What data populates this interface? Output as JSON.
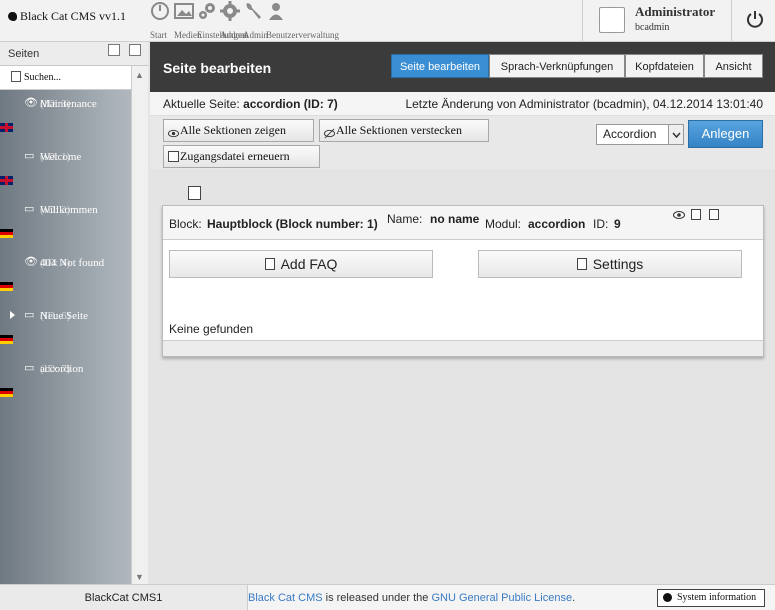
{
  "app": {
    "title": "Black Cat CMS vv1.1"
  },
  "topnav": {
    "items": [
      {
        "label": "Start",
        "icon": "dashboard-icon"
      },
      {
        "label": "Medien",
        "icon": "image-icon"
      },
      {
        "label": "Einstellungen",
        "icon": "gears-icon"
      },
      {
        "label": "Addons",
        "icon": "puzzle-gear-icon"
      },
      {
        "label": "Admin",
        "icon": "wrench-icon"
      },
      {
        "label": "Benutzerverwaltung",
        "icon": "users-icon"
      }
    ]
  },
  "user": {
    "display_name": "Administrator",
    "login": "bcadmin"
  },
  "sidebar": {
    "title": "Seiten",
    "search_label": "Suchen...",
    "pages": [
      {
        "name": "Maintenance",
        "id": "(ID: 3)",
        "icon": "eye-icon",
        "flag": "uk",
        "expandable": false
      },
      {
        "name": "Welcome",
        "id": "(ID: 1)",
        "icon": "monitor-icon",
        "flag": "uk",
        "expandable": false
      },
      {
        "name": "Willkommen",
        "id": "(ID: 2)",
        "icon": "monitor-icon",
        "flag": "de",
        "expandable": false
      },
      {
        "name": "404 Not found",
        "id": "(ID: 4)",
        "icon": "eye-icon",
        "flag": "de",
        "expandable": false
      },
      {
        "name": "Neue Seite",
        "id": "(ID: 6)",
        "icon": "monitor-icon",
        "flag": "de",
        "expandable": true
      },
      {
        "name": "accordion",
        "id": "(ID: 7)",
        "icon": "monitor-icon",
        "flag": "de",
        "expandable": false
      }
    ]
  },
  "panel": {
    "title": "Seite bearbeiten",
    "tabs": [
      {
        "label": "Seite bearbeiten",
        "active": true
      },
      {
        "label": "Sprach-Verknüpfungen",
        "active": false
      },
      {
        "label": "Kopfdateien",
        "active": false
      },
      {
        "label": "Ansicht",
        "active": false
      }
    ]
  },
  "info": {
    "current_page_label": "Aktuelle Seite:",
    "current_page_value": "accordion (ID: 7)",
    "last_change": "Letzte Änderung von Administrator (bcadmin), 04.12.2014 13:01:40"
  },
  "toolbar": {
    "show_all": "Alle Sektionen zeigen",
    "hide_all": "Alle Sektionen verstecken",
    "renew_access": "Zugangsdatei erneuern",
    "section_type_selected": "Accordion",
    "add_button": "Anlegen"
  },
  "block": {
    "block_label": "Block:",
    "block_value": "Hauptblock (Block number: 1)",
    "name_label": "Name:",
    "name_value": "no name",
    "module_label": "Modul:",
    "module_value": "accordion",
    "id_label": "ID:",
    "id_value": "9",
    "add_faq": "Add FAQ",
    "settings": "Settings",
    "empty_text": "Keine gefunden"
  },
  "footer": {
    "version": "BlackCat CMS1",
    "license_link1": "Black Cat CMS",
    "license_middle": " is released under the ",
    "license_link2": "GNU General Public License",
    "license_end": ".",
    "sysinfo_button": "System information"
  },
  "colors": {
    "accent": "#3a8ed3",
    "header_dark": "#3b3b3b",
    "link": "#3a7bc4"
  }
}
